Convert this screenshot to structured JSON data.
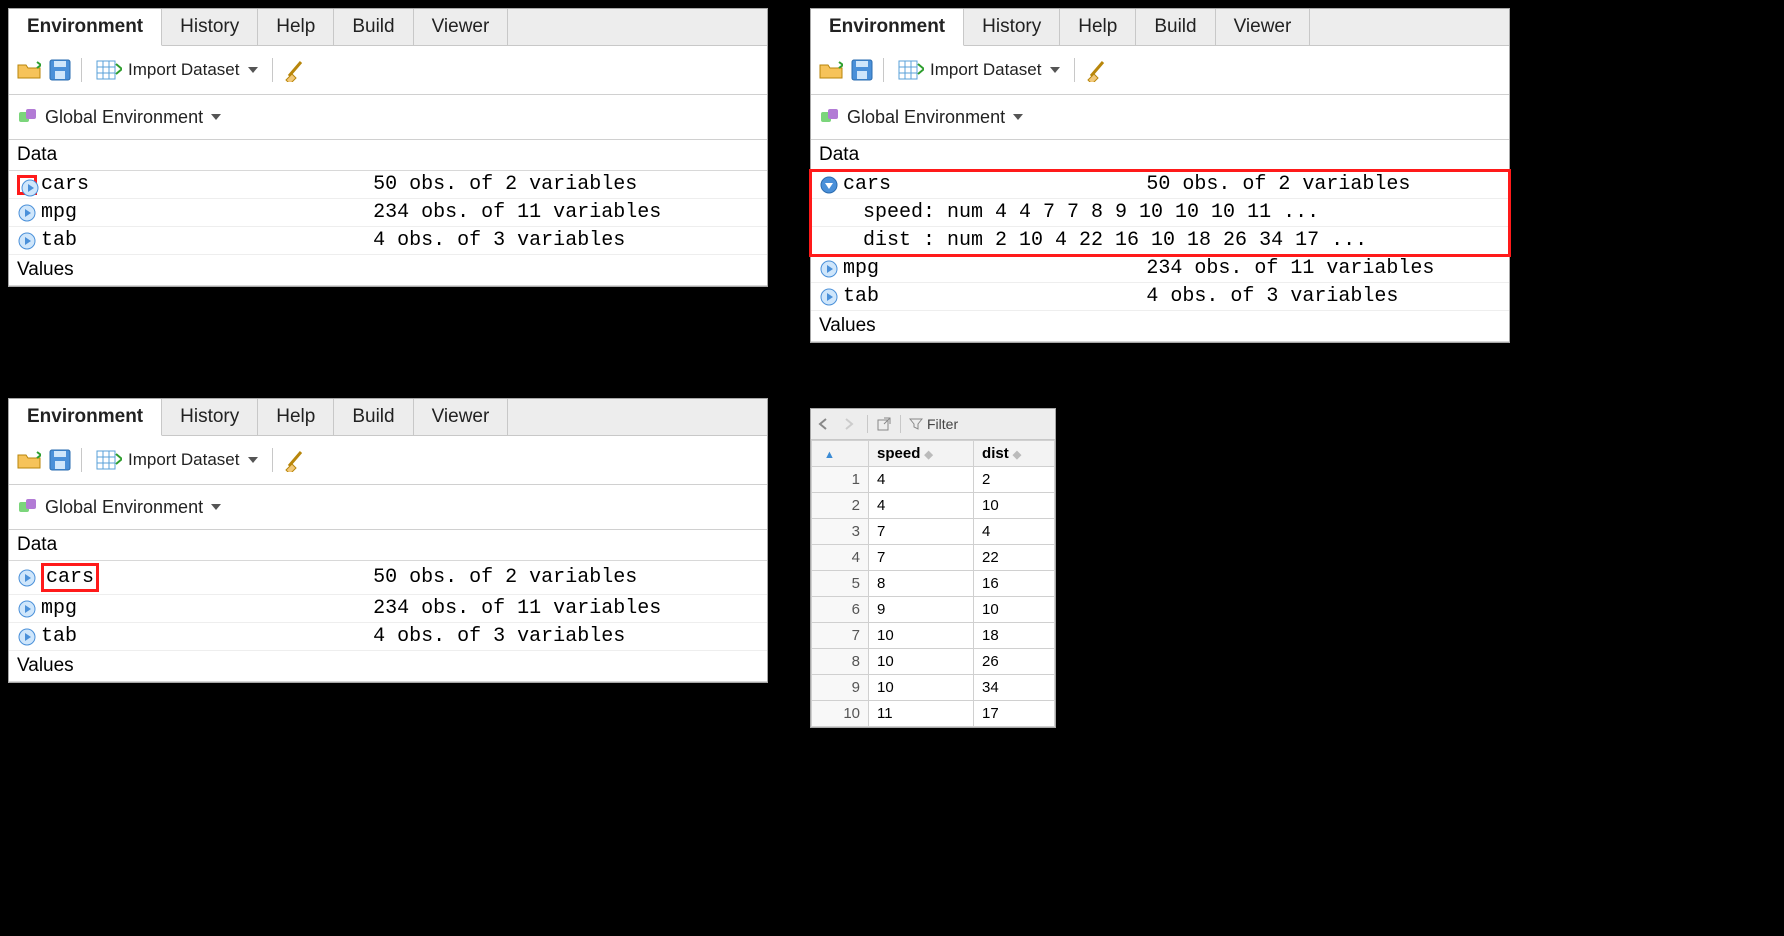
{
  "tabs": {
    "environment": "Environment",
    "history": "History",
    "help": "Help",
    "build": "Build",
    "viewer": "Viewer"
  },
  "toolbar": {
    "import": "Import Dataset",
    "global_env": "Global Environment"
  },
  "sections": {
    "data": "Data",
    "values": "Values"
  },
  "panelA": {
    "rows": [
      {
        "name": "cars",
        "desc": "50 obs. of 2 variables"
      },
      {
        "name": "mpg",
        "desc": "234 obs. of 11 variables"
      },
      {
        "name": "tab",
        "desc": "4 obs. of 3 variables"
      }
    ]
  },
  "panelB": {
    "rows": [
      {
        "name": "cars",
        "desc": "50 obs. of 2 variables",
        "expanded": true,
        "children": [
          "speed: num 4 4 7 7 8 9 10 10 10 11 ...",
          "dist : num 2 10 4 22 16 10 18 26 34 17 ..."
        ]
      },
      {
        "name": "mpg",
        "desc": "234 obs. of 11 variables"
      },
      {
        "name": "tab",
        "desc": "4 obs. of 3 variables"
      }
    ]
  },
  "panelC": {
    "rows": [
      {
        "name": "cars",
        "desc": "50 obs. of 2 variables"
      },
      {
        "name": "mpg",
        "desc": "234 obs. of 11 variables"
      },
      {
        "name": "tab",
        "desc": "4 obs. of 3 variables"
      }
    ]
  },
  "viewer": {
    "filter": "Filter",
    "cols": [
      "speed",
      "dist"
    ],
    "rows": [
      {
        "n": "1",
        "speed": "4",
        "dist": "2"
      },
      {
        "n": "2",
        "speed": "4",
        "dist": "10"
      },
      {
        "n": "3",
        "speed": "7",
        "dist": "4"
      },
      {
        "n": "4",
        "speed": "7",
        "dist": "22"
      },
      {
        "n": "5",
        "speed": "8",
        "dist": "16"
      },
      {
        "n": "6",
        "speed": "9",
        "dist": "10"
      },
      {
        "n": "7",
        "speed": "10",
        "dist": "18"
      },
      {
        "n": "8",
        "speed": "10",
        "dist": "26"
      },
      {
        "n": "9",
        "speed": "10",
        "dist": "34"
      },
      {
        "n": "10",
        "speed": "11",
        "dist": "17"
      }
    ]
  }
}
